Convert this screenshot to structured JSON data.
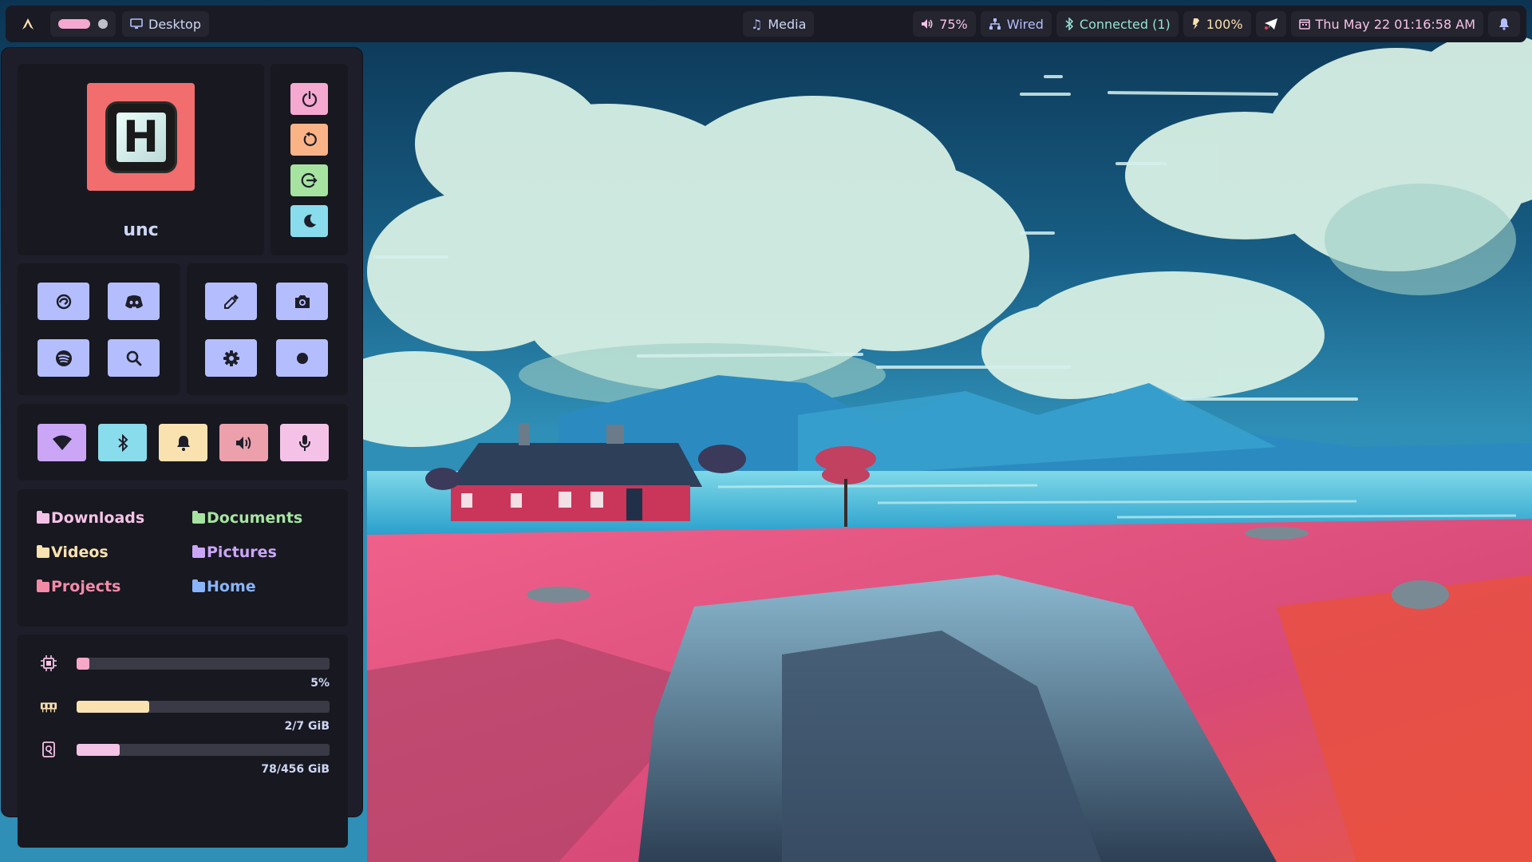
{
  "topbar": {
    "launcher_icon": "arch-logo-icon",
    "workspace": {
      "active_color": "#f5a8d0",
      "inactive_color": "#bfbfc9"
    },
    "desktop_label": "Desktop",
    "media_label": "Media",
    "volume_label": "75%",
    "network_label": "Wired",
    "bluetooth_label": "Connected (1)",
    "battery_label": "100%",
    "datetime_label": "Thu May 22  01:16:58 AM",
    "icons": [
      "volume-icon",
      "network-icon",
      "bluetooth-icon",
      "battery-icon",
      "telegram-icon",
      "calendar-icon",
      "notification-icon"
    ]
  },
  "profile": {
    "avatar_letter": "H",
    "avatar_bg": "#f26d6d",
    "username": "unc"
  },
  "power": {
    "buttons": [
      {
        "name": "power",
        "icon": "power-icon",
        "color": "#f5a8d0"
      },
      {
        "name": "reboot",
        "icon": "reboot-icon",
        "color": "#fab387"
      },
      {
        "name": "logout",
        "icon": "logout-icon",
        "color": "#a6e3a1"
      },
      {
        "name": "sleep",
        "icon": "moon-icon",
        "color": "#89dceb"
      }
    ]
  },
  "apps": {
    "color": "#b4befe",
    "group1": [
      "browser-icon",
      "discord-icon",
      "spotify-icon",
      "search-icon"
    ],
    "group2": [
      "color-picker-icon",
      "screenshot-icon",
      "settings-icon",
      "record-icon"
    ]
  },
  "toggles": [
    {
      "icon": "wifi-icon",
      "color": "#cba6f7"
    },
    {
      "icon": "bluetooth-icon",
      "color": "#89dceb"
    },
    {
      "icon": "bell-icon",
      "color": "#f9e2af"
    },
    {
      "icon": "speaker-icon",
      "color": "#eba0ac"
    },
    {
      "icon": "microphone-icon",
      "color": "#f5c2e7"
    }
  ],
  "folders": [
    {
      "label": "Downloads",
      "color": "#f5c2e7"
    },
    {
      "label": "Documents",
      "color": "#a6e3a1"
    },
    {
      "label": "Videos",
      "color": "#f9e2af"
    },
    {
      "label": "Pictures",
      "color": "#cba6f7"
    },
    {
      "label": "Projects",
      "color": "#f38ba8"
    },
    {
      "label": "Home",
      "color": "#89b4fa"
    }
  ],
  "stats": {
    "cpu": {
      "icon": "cpu-icon",
      "fraction": 0.05,
      "label": "5%",
      "color": "#f5a8c8"
    },
    "ram": {
      "icon": "ram-icon",
      "fraction": 0.2857,
      "label": "2/7 GiB",
      "color": "#f9e2af"
    },
    "disk": {
      "icon": "disk-icon",
      "fraction": 0.171,
      "label": "78/456 GiB",
      "color": "#f5c2e7"
    }
  }
}
